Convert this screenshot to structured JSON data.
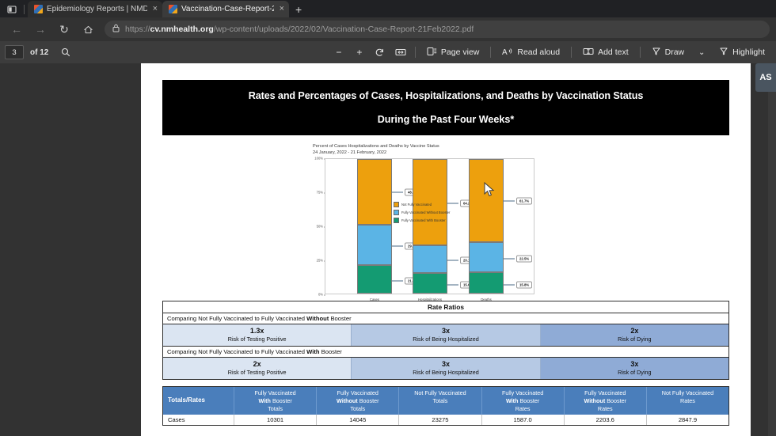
{
  "browser": {
    "tabs": [
      {
        "title": "Epidemiology Reports | NMDOH",
        "active": false,
        "close_label": "×"
      },
      {
        "title": "Vaccination-Case-Report-21Feb",
        "active": true,
        "close_label": "×"
      }
    ],
    "new_tab_label": "+",
    "nav": {
      "back": "←",
      "forward": "→",
      "reload": "↻",
      "home": "⌂",
      "lock": "🔒"
    },
    "url_scheme": "https://",
    "url_domain": "cv.nmhealth.org",
    "url_path": "/wp-content/uploads/2022/02/Vaccination-Case-Report-21Feb2022.pdf"
  },
  "pdf_toolbar": {
    "page_number": "3",
    "page_count": "of 12",
    "search_icon": "⚲",
    "zoom_out": "−",
    "zoom_in": "+",
    "rotate": "⟳",
    "fit_page": "⬚",
    "page_view": "Page view",
    "read_aloud": "Read aloud",
    "read_aloud_icon": "A",
    "add_text": "Add text",
    "draw": "Draw",
    "draw_caret": "⌄",
    "highlight": "Highlight"
  },
  "side_panel": {
    "label": "AS"
  },
  "document": {
    "header_line1": "Rates and Percentages of Cases, Hospitalizations, and Deaths by Vaccination Status",
    "header_line2": "During the Past Four Weeks*"
  },
  "chart_data": {
    "type": "bar",
    "stacked": true,
    "title": "Percent of Cases Hospitalizations and Deaths by Vaccine Status",
    "subtitle": "24 January, 2022 - 21 February, 2022",
    "xlabel": "",
    "ylabel": "",
    "categories": [
      "Cases",
      "Hospitalizations",
      "Deaths"
    ],
    "ylim": [
      0,
      100
    ],
    "yticks": [
      "0%",
      "25%",
      "50%",
      "75%",
      "100%"
    ],
    "grid": false,
    "legend_position": "right",
    "series": [
      {
        "name": "Fully Vaccinated With Booster",
        "color": "#149b72",
        "values": [
          21.6,
          15.6,
          15.8
        ],
        "labels": [
          "21.6%",
          "15.6%",
          "15.8%"
        ]
      },
      {
        "name": "Fully Vaccinated Without Booster",
        "color": "#5bb4e5",
        "values": [
          29.5,
          20.1,
          22.5
        ],
        "labels": [
          "29.5%",
          "20.1%",
          "22.5%"
        ]
      },
      {
        "name": "Not Fully Vaccinated",
        "color": "#eda00d",
        "values": [
          48.9,
          64.2,
          61.7
        ],
        "labels": [
          "48.9%",
          "64.2%",
          "61.7%"
        ]
      }
    ],
    "legend_order": [
      "Not Fully Vaccinated",
      "Fully Vaccinated Without Booster",
      "Fully Vaccinated With Booster"
    ]
  },
  "rate_ratios": {
    "title": "Rate Ratios",
    "sections": [
      {
        "caption_pre": "Comparing Not Fully Vaccinated to Fully Vaccinated ",
        "caption_bold": "Without",
        "caption_post": " Booster",
        "cells": [
          {
            "mult": "1.3x",
            "risk": "Risk of Testing Positive"
          },
          {
            "mult": "3x",
            "risk": "Risk of Being Hospitalized"
          },
          {
            "mult": "2x",
            "risk": "Risk of Dying"
          }
        ]
      },
      {
        "caption_pre": "Comparing Not Fully Vaccinated to Fully Vaccinated ",
        "caption_bold": "With",
        "caption_post": " Booster",
        "cells": [
          {
            "mult": "2x",
            "risk": "Risk of Testing Positive"
          },
          {
            "mult": "3x",
            "risk": "Risk of Being Hospitalized"
          },
          {
            "mult": "3x",
            "risk": "Risk of Dying"
          }
        ]
      }
    ]
  },
  "totals_table": {
    "columns": [
      {
        "l1": "Totals/Rates",
        "l2": "",
        "l3": ""
      },
      {
        "l1": "Fully Vaccinated",
        "l2": "With Booster",
        "l3": "Totals"
      },
      {
        "l1": "Fully Vaccinated",
        "l2": "Without Booster",
        "l3": "Totals"
      },
      {
        "l1": "Not Fully Vaccinated",
        "l2": "Totals",
        "l3": ""
      },
      {
        "l1": "Fully Vaccinated",
        "l2": "With Booster",
        "l3": "Rates"
      },
      {
        "l1": "Fully Vaccinated",
        "l2": "Without Booster",
        "l3": "Rates"
      },
      {
        "l1": "Not Fully Vaccinated",
        "l2": "Rates",
        "l3": ""
      }
    ],
    "rows": [
      [
        "Cases",
        "10301",
        "14045",
        "23275",
        "1587.0",
        "2203.6",
        "2847.9"
      ]
    ]
  }
}
